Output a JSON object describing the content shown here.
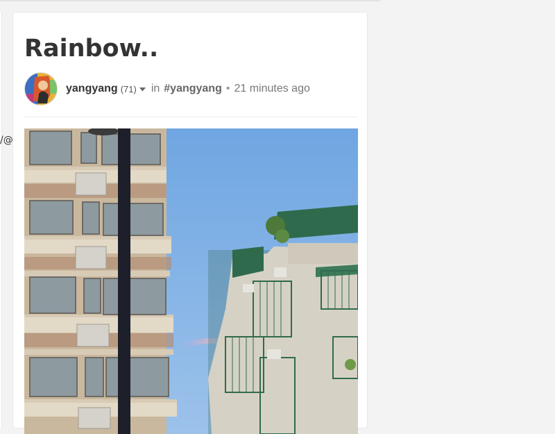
{
  "left_fragment": "/@",
  "post": {
    "title": "Rainbow..",
    "author": "yangyang",
    "reputation": "(71)",
    "in_label": "in",
    "community": "#yangyang",
    "separator": "•",
    "time_ago": "21 minutes ago"
  },
  "icons": {
    "caret": "caret-down-icon",
    "avatar": "user-avatar-image"
  },
  "colors": {
    "background": "#f3f3f3",
    "card": "#ffffff",
    "text": "#333333",
    "muted": "#777777",
    "sky": "#7fb0e3"
  }
}
